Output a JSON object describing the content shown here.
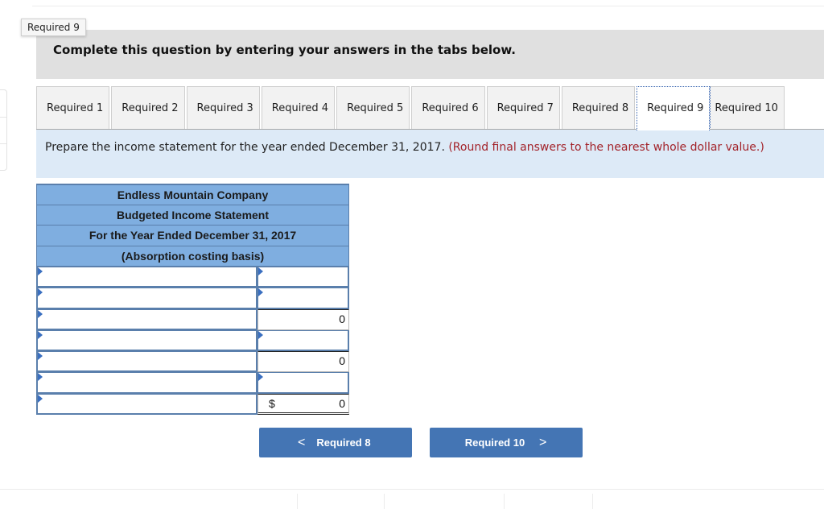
{
  "tag_label": "Required 9",
  "instruction": "Complete this question by entering your answers in the tabs below.",
  "tabs": [
    {
      "label": "Required 1",
      "active": false
    },
    {
      "label": "Required 2",
      "active": false
    },
    {
      "label": "Required 3",
      "active": false
    },
    {
      "label": "Required 4",
      "active": false
    },
    {
      "label": "Required 5",
      "active": false
    },
    {
      "label": "Required 6",
      "active": false
    },
    {
      "label": "Required 7",
      "active": false
    },
    {
      "label": "Required 8",
      "active": false
    },
    {
      "label": "Required 9",
      "active": true
    },
    {
      "label": "Required 10",
      "active": false
    }
  ],
  "prompt": {
    "text": "Prepare the income statement for the year ended December 31, 2017.",
    "hint": "(Round final answers to the nearest whole dollar value.)"
  },
  "statement": {
    "headers": [
      "Endless Mountain Company",
      "Budgeted Income Statement",
      "For the Year Ended December 31, 2017",
      "(Absorption costing basis)"
    ],
    "rows": [
      {
        "label": "",
        "amount": "",
        "amount_type": "input",
        "currency": ""
      },
      {
        "label": "",
        "amount": "",
        "amount_type": "input",
        "currency": ""
      },
      {
        "label": "",
        "amount": "0",
        "amount_type": "calc",
        "currency": ""
      },
      {
        "label": "",
        "amount": "",
        "amount_type": "input",
        "currency": ""
      },
      {
        "label": "",
        "amount": "0",
        "amount_type": "calc",
        "currency": ""
      },
      {
        "label": "",
        "amount": "",
        "amount_type": "input",
        "currency": ""
      },
      {
        "label": "",
        "amount": "0",
        "amount_type": "total",
        "currency": "$"
      }
    ]
  },
  "nav": {
    "prev_label": "Required 8",
    "next_label": "Required 10",
    "prev_icon": "chevron-left-icon",
    "next_icon": "chevron-right-icon",
    "prev_glyph": "<",
    "next_glyph": ">"
  },
  "colors": {
    "header_fill": "#7faee0",
    "button_fill": "#4475b4",
    "prompt_fill": "#ddeaf7",
    "hint_text": "#a3232a"
  }
}
